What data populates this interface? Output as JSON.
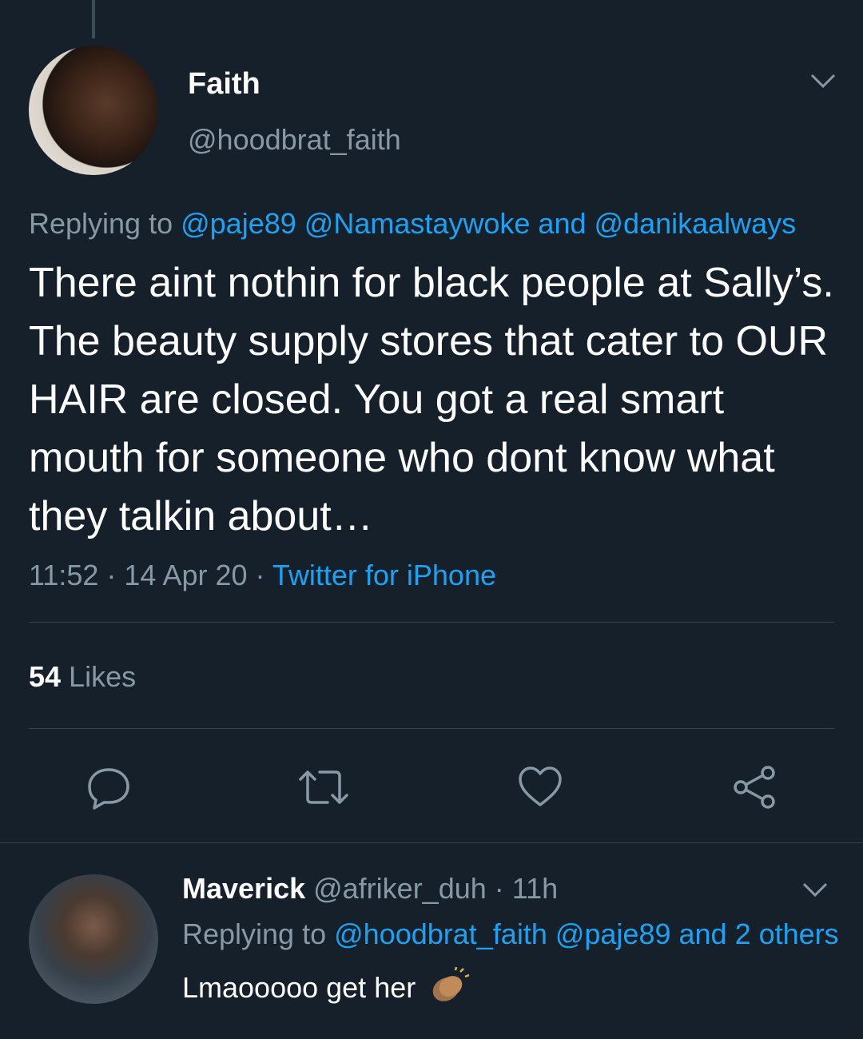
{
  "tweet": {
    "author_name": "Faith",
    "author_handle": "@hoodbrat_faith",
    "replying_prefix": "Replying to ",
    "replying_mention1": "@paje89",
    "replying_mention2": "@Namastaywoke",
    "replying_and": " and ",
    "replying_mention3": "@danikaalways",
    "text": "There aint nothin for black people at Sally’s. The beauty supply stores that cater to OUR HAIR are closed. You got a real smart mouth for someone who dont know what they talkin about…",
    "time_date": "11:52 · 14 Apr 20 · ",
    "source": "Twitter for iPhone",
    "likes_count": "54",
    "likes_label": " Likes",
    "icons": [
      "reply-icon",
      "retweet-icon",
      "like-icon",
      "share-icon",
      "chevron-down-icon"
    ]
  },
  "reply": {
    "author_name": "Maverick",
    "author_handle": " @afriker_duh",
    "time": " · 11h",
    "replying_prefix": "Replying to ",
    "replying_mention1": "@hoodbrat_faith",
    "replying_mention2": " @paje89",
    "replying_rest": " and 2 others",
    "text": "Lmaooooo get her",
    "emoji": "clapping-hands-emoji"
  },
  "colors": {
    "background": "#15202b",
    "secondary_text": "#8899a6",
    "link": "#1da1f2",
    "divider": "#38444d"
  }
}
